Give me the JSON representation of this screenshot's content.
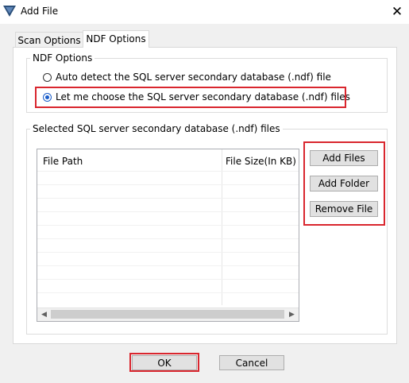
{
  "window": {
    "title": "Add File",
    "close_label": "✕"
  },
  "tabs": [
    {
      "label": "Scan Options",
      "active": false
    },
    {
      "label": "NDF Options",
      "active": true
    }
  ],
  "ndf_options": {
    "group_label": "NDF Options",
    "radio_auto_label": "Auto detect the SQL server secondary database (.ndf) file",
    "radio_choose_label": "Let me choose the SQL server secondary database (.ndf) files",
    "selected": "choose"
  },
  "selected_files": {
    "group_label": "Selected SQL server  secondary database (.ndf) files",
    "columns": [
      "File Path",
      "File Size(In KB)"
    ],
    "rows": []
  },
  "buttons": {
    "add_files": "Add Files",
    "add_folder": "Add Folder",
    "remove_file": "Remove File",
    "ok": "OK",
    "cancel": "Cancel"
  },
  "icons": {
    "app": "app-logo-icon",
    "close": "close-icon",
    "scroll_left": "chevron-left-icon",
    "scroll_right": "chevron-right-icon"
  },
  "colors": {
    "highlight": "#d9262e",
    "radio_selected": "#1a5dc9",
    "dialog_bg": "#f0f0f0"
  }
}
